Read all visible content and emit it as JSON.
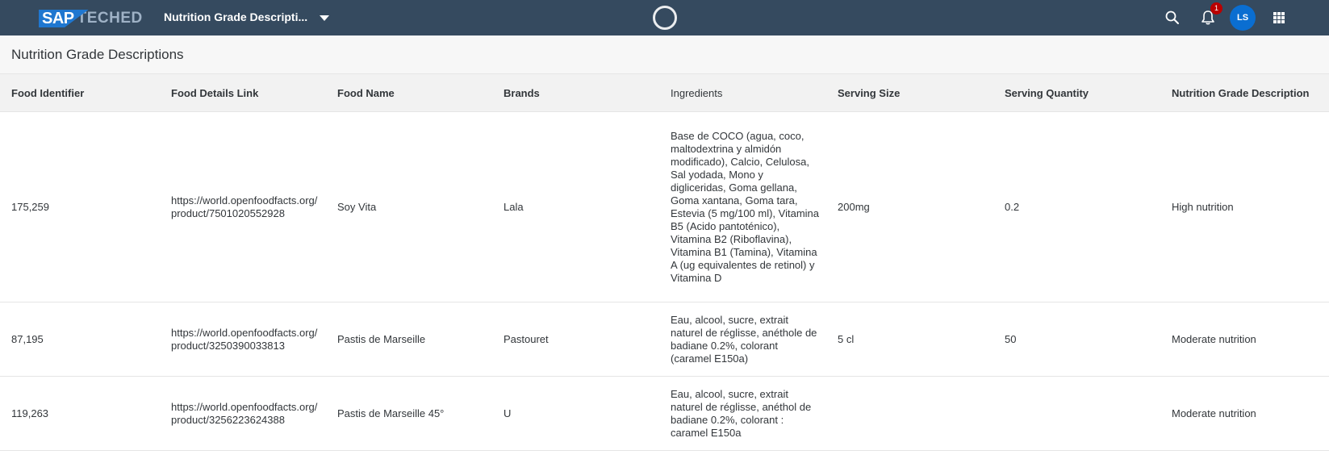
{
  "shellbar": {
    "logo_sap": "SAP",
    "logo_teched": "TECHED",
    "app_title": "Nutrition Grade Descripti...",
    "notification_count": "1",
    "avatar_initials": "LS",
    "icons": [
      "search-icon",
      "bell-icon",
      "app-grid-icon"
    ],
    "bg_color": "#354a5f",
    "accent_color": "#0a6ed1"
  },
  "page": {
    "title": "Nutrition Grade Descriptions"
  },
  "table": {
    "columns": [
      "Food Identifier",
      "Food Details Link",
      "Food Name",
      "Brands",
      "Ingredients",
      "Serving Size",
      "Serving Quantity",
      "Nutrition Grade Description"
    ],
    "rows": [
      {
        "id": "175,259",
        "link": "https://world.openfoodfacts.org/product/7501020552928",
        "name": "Soy Vita",
        "brand": "Lala",
        "ingredients": "Base de COCO (agua, coco, maltodextrina y almidón modificado), Calcio, Celulosa, Sal yodada, Mono y digliceridas, Goma gellana, Goma xantana, Goma tara, Estevia (5 mg/100 ml), Vitamina B5 (Acido pantoténico), Vitamina B2 (Riboflavina), Vitamina B1 (Tamina), Vitamina A (ug equivalentes de retinol) y Vitamina D",
        "serving_size": "200mg",
        "serving_quantity": "0.2",
        "grade": "High nutrition"
      },
      {
        "id": "87,195",
        "link": "https://world.openfoodfacts.org/product/3250390033813",
        "name": "Pastis de Marseille",
        "brand": "Pastouret",
        "ingredients": "Eau, alcool, sucre, extrait naturel de réglisse, anéthole de badiane 0.2%, colorant (caramel E150a)",
        "serving_size": "5 cl",
        "serving_quantity": "50",
        "grade": "Moderate nutrition"
      },
      {
        "id": "119,263",
        "link": "https://world.openfoodfacts.org/product/3256223624388",
        "name": "Pastis de Marseille 45°",
        "brand": "U",
        "ingredients": "Eau, alcool, sucre, extrait naturel de réglisse, anéthol de badiane 0.2%, colorant : caramel E150a",
        "serving_size": "",
        "serving_quantity": "",
        "grade": "Moderate nutrition"
      }
    ]
  }
}
